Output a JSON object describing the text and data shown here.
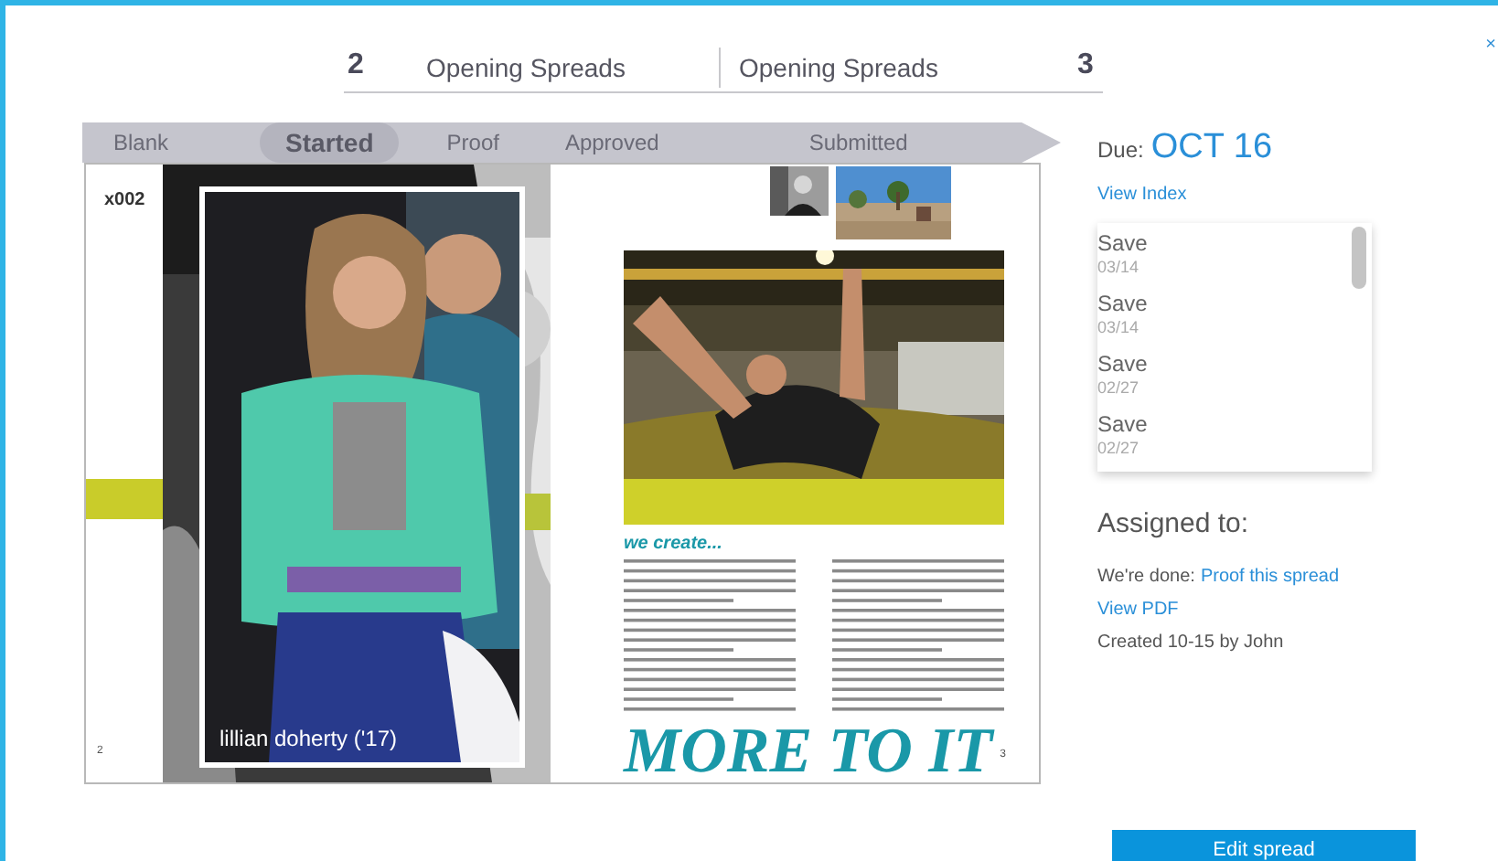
{
  "window": {
    "close": "×"
  },
  "header": {
    "left_number": "2",
    "left_title": "Opening Spreads",
    "right_title": "Opening Spreads",
    "right_number": "3"
  },
  "stages": [
    {
      "label": "Blank",
      "selected": false
    },
    {
      "label": "Started",
      "selected": true
    },
    {
      "label": "Proof",
      "selected": false
    },
    {
      "label": "Approved",
      "selected": false
    },
    {
      "label": "Submitted",
      "selected": false
    }
  ],
  "spread": {
    "left_page": {
      "code": "x002",
      "caption": "lillian doherty ('17)",
      "page_number": "2"
    },
    "right_page": {
      "heading": "we create...",
      "headline": "MORE TO IT",
      "page_number": "3"
    }
  },
  "panel": {
    "due_label": "Due:",
    "due_date": "OCT 16",
    "view_index": "View Index",
    "history": [
      {
        "action": "Save",
        "date": "03/14"
      },
      {
        "action": "Save",
        "date": "03/14"
      },
      {
        "action": "Save",
        "date": "02/27"
      },
      {
        "action": "Save",
        "date": "02/27"
      }
    ],
    "assigned_label": "Assigned to:",
    "status_text": "We're done:",
    "proof_link": "Proof this spread",
    "view_pdf": "View PDF",
    "created": "Created 10-15 by John",
    "edit_button": "Edit spread"
  }
}
